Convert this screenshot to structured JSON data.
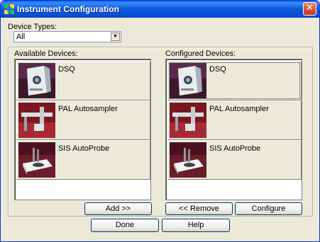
{
  "window": {
    "title": "Instrument Configuration",
    "close_glyph": "✕"
  },
  "device_types": {
    "label": "Device Types:",
    "selected": "All",
    "arrow": "▼"
  },
  "available": {
    "label": "Available Devices:",
    "items": [
      {
        "label": "DSQ",
        "icon": "dsq-instrument-image"
      },
      {
        "label": "PAL Autosampler",
        "icon": "pal-autosampler-image"
      },
      {
        "label": "SIS AutoProbe",
        "icon": "sis-autoprobe-image"
      }
    ],
    "add_button": "Add >>"
  },
  "configured": {
    "label": "Configured Devices:",
    "items": [
      {
        "label": "DSQ",
        "icon": "dsq-instrument-image"
      },
      {
        "label": "PAL Autosampler",
        "icon": "pal-autosampler-image"
      },
      {
        "label": "SIS AutoProbe",
        "icon": "sis-autoprobe-image"
      }
    ],
    "remove_button": "<< Remove",
    "configure_button": "Configure"
  },
  "footer": {
    "done_button": "Done",
    "help_button": "Help"
  },
  "colors": {
    "titlebar": "#0a5fe8",
    "thumb_bg": "#7a1f2a",
    "dialog_bg": "#ece9d8"
  }
}
